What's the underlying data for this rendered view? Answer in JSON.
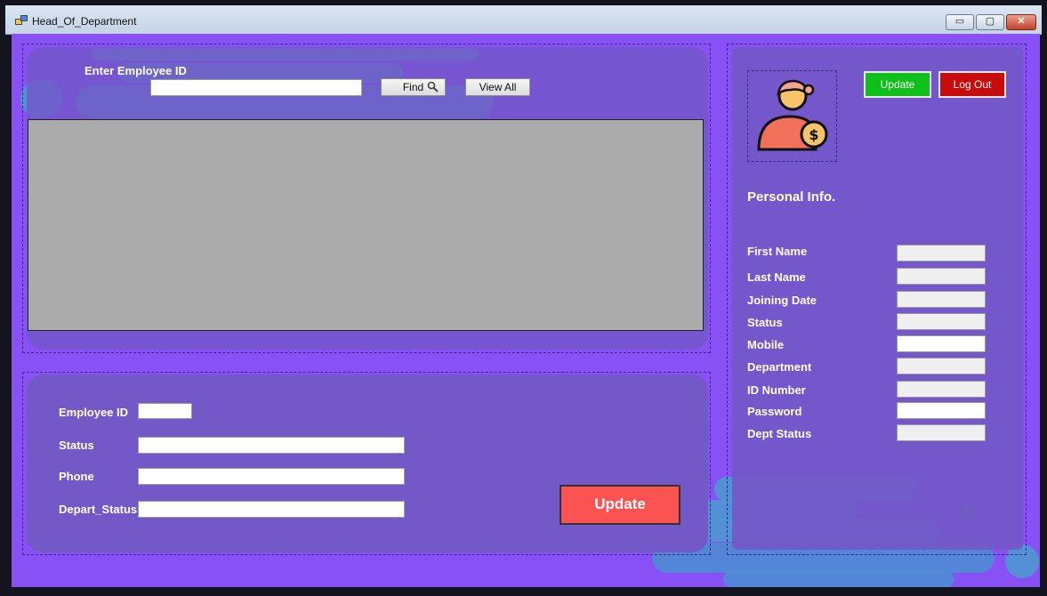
{
  "window": {
    "title": "Head_Of_Department",
    "min_glyph": "▭",
    "max_glyph": "▢",
    "close_glyph": "✕"
  },
  "search": {
    "label": "Enter Employee ID",
    "value": "",
    "find_label": "Find",
    "view_all_label": "View All"
  },
  "edit_form": {
    "employee_id_label": "Employee ID",
    "status_label": "Status",
    "phone_label": "Phone",
    "depart_status_label": "Depart_Status",
    "update_label": "Update"
  },
  "profile": {
    "update_label": "Update",
    "logout_label": "Log Out",
    "section_title": "Personal Info.",
    "fields": [
      {
        "label": "First Name",
        "value": ""
      },
      {
        "label": "Last Name",
        "value": ""
      },
      {
        "label": "Joining Date",
        "value": ""
      },
      {
        "label": "Status",
        "value": ""
      },
      {
        "label": "Mobile",
        "value": ""
      },
      {
        "label": "Department",
        "value": ""
      },
      {
        "label": "ID Number",
        "value": ""
      },
      {
        "label": "Password",
        "value": ""
      },
      {
        "label": "Dept Status",
        "value": ""
      }
    ]
  },
  "colors": {
    "background": "#8851f5",
    "panel": "#7358c8",
    "accent_green": "#10c01a",
    "accent_red": "#c80c0c",
    "update_red": "#fb5252"
  },
  "icons": {
    "app": "app-window-icon",
    "search": "magnifier-icon",
    "avatar": "employee-salary-avatar-icon"
  }
}
